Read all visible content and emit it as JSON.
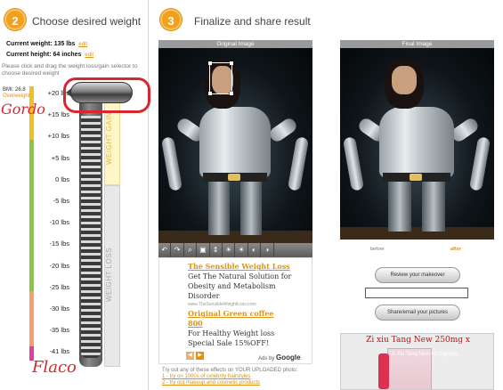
{
  "step2": {
    "number": "2",
    "title": "Choose desired weight"
  },
  "step3": {
    "number": "3",
    "title": "Finalize and share result"
  },
  "stats": {
    "current_weight_label": "Current weight:",
    "current_weight_value": "135 lbs",
    "current_height_label": "Current height:",
    "current_height_value": "64 inches",
    "edit_label": "edit"
  },
  "hint": "Please click and drag the weight loss/gain selector to choose desired weight",
  "bmi": {
    "label": "BMI: 26.8",
    "status": "Overweight"
  },
  "ticks": [
    "+20 lbs",
    "+15 lbs",
    "+10 lbs",
    "+5 lbs",
    "0 lbs",
    "-5 lbs",
    "-10 lbs",
    "-15 lbs",
    "-20 lbs",
    "-25 lbs",
    "-30 lbs",
    "-35 lbs",
    "-41 lbs"
  ],
  "slider": {
    "gain_label": "WEIGHT GAIN",
    "loss_label": "WEIGHT LOSS",
    "selected_lbs": 20
  },
  "annotations": {
    "top": "Gordo",
    "bottom": "Flaco"
  },
  "images": {
    "original_header": "Original Image",
    "final_header": "Final Image"
  },
  "toolbar": {
    "tools": [
      "↶",
      "↷",
      "⌕",
      "▣",
      "⇕",
      "☀",
      "☀",
      "◐",
      "◑"
    ]
  },
  "ad": {
    "ad1_title": "The Sensible Weight Loss",
    "ad1_text": "Get The Natural Solution for Obesity and Metabolism Disorder",
    "ad1_url": "www.TheSensibleWeightLoss.com",
    "ad2_title": "Original Green coffee 800",
    "ad2_text": "For Healthy Weight loss Special Sale 15%OFF!",
    "ads_by": "Ads by",
    "ads_brand": "Google"
  },
  "try_text": {
    "intro": "Try out any of these effects on YOUR UPLOADED photo:",
    "link1": "1 - try on 1000s of celebrity hairstyles",
    "link2": "2 - try out makeup and cosmetic products"
  },
  "final_captions": {
    "before": "before",
    "after": "after"
  },
  "buttons": {
    "review": "Review your makeover",
    "share": "Share/email your pictures"
  },
  "side_ad": {
    "title": "Zi xiu Tang New 250mg x",
    "sub": "Zi Xiu Tang New 60 Capsule"
  },
  "colors": {
    "accent": "#f0a020",
    "annotation": "#d8262e",
    "link": "#e09010"
  }
}
